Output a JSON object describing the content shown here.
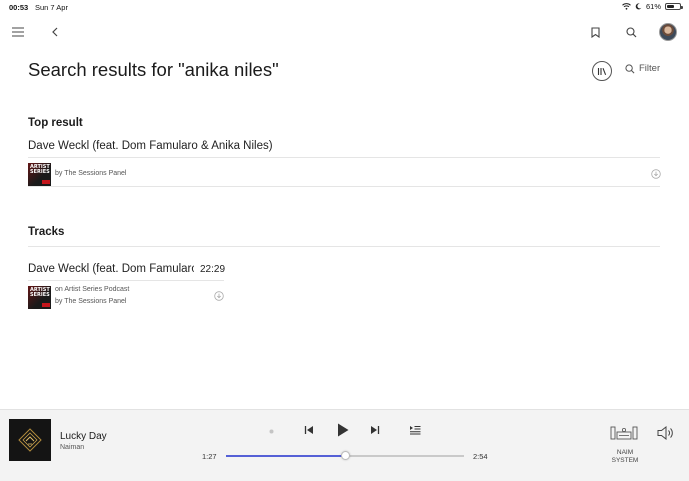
{
  "status_bar": {
    "time": "00:53",
    "date": "Sun 7 Apr",
    "battery": "61%",
    "battery_level": 0.61
  },
  "nav": {
    "menu_icon": "hamburger-menu-icon",
    "back_icon": "chevron-left-icon",
    "bookmark_icon": "bookmark-icon",
    "search_icon": "search-icon"
  },
  "page": {
    "title": "Search results for \"anika niles\"",
    "filter_label": "Filter"
  },
  "top_result": {
    "heading": "Top result",
    "title": "Dave Weckl (feat. Dom Famularo & Anika Niles)",
    "by_line": "by The Sessions Panel",
    "thumb_text": "ARTIST SERIES"
  },
  "tracks": {
    "heading": "Tracks",
    "items": [
      {
        "title": "Dave Weckl (feat. Dom Famularo",
        "duration": "22:29",
        "source_line": "on Artist Series Podcast",
        "by_line": "by The Sessions Panel",
        "thumb_text": "ARTIST SERIES"
      }
    ]
  },
  "player": {
    "track_name": "Lucky Day",
    "artist": "Naiman",
    "elapsed": "1:27",
    "total": "2:54",
    "progress_fraction": 0.5,
    "system_label_line1": "NAIM",
    "system_label_line2": "SYSTEM",
    "accent_color": "#5560d6"
  }
}
